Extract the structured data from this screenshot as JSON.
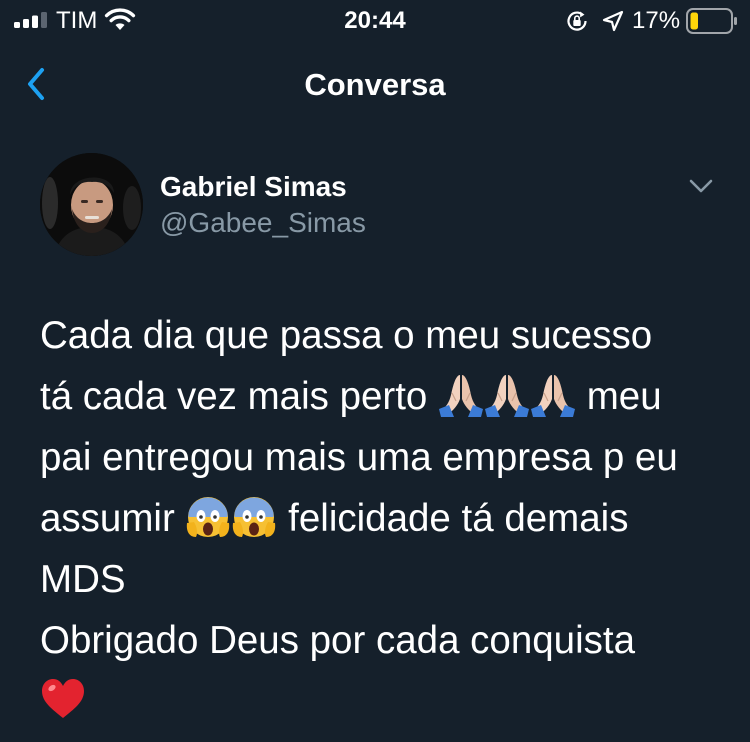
{
  "status_bar": {
    "carrier": "TIM",
    "time": "20:44",
    "battery_percent": "17%",
    "icons": [
      "signal-icon",
      "wifi-icon",
      "rotation-lock-icon",
      "location-icon",
      "battery-icon"
    ]
  },
  "nav": {
    "title": "Conversa",
    "back_icon": "chevron-left-icon"
  },
  "tweet": {
    "author_name": "Gabriel Simas",
    "author_handle": "@Gabee_Simas",
    "menu_icon": "chevron-down-icon",
    "lines": {
      "l1": "Cada dia que passa o meu sucesso",
      "l2a": "tá cada vez mais perto ",
      "l2b": " meu",
      "l3": "pai entregou mais uma empresa p eu",
      "l4a": "assumir ",
      "l4b": " felicidade tá demais",
      "l5": "MDS",
      "l6": "Obrigado Deus por cada conquista"
    },
    "emojis": [
      "folded-hands-emoji",
      "screaming-face-emoji",
      "red-heart-emoji"
    ]
  },
  "colors": {
    "background": "#15202b",
    "accent": "#1da1f2",
    "secondary_text": "#8899a6",
    "battery_low": "#ffd60a"
  }
}
